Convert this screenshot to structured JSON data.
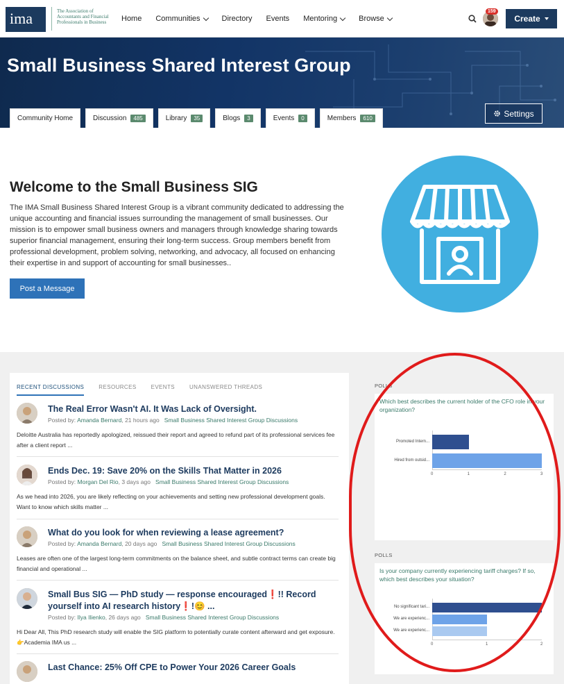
{
  "header": {
    "logo": "ima",
    "logo_text": "The Association of Accountants and Financial Professionals in Business",
    "nav": [
      "Home",
      "Communities",
      "Directory",
      "Events",
      "Mentoring",
      "Browse"
    ],
    "notifications": "159",
    "create_label": "Create"
  },
  "banner": {
    "title": "Small Business Shared Interest Group",
    "settings_label": "Settings",
    "tabs": [
      {
        "label": "Community Home",
        "count": ""
      },
      {
        "label": "Discussion",
        "count": "485"
      },
      {
        "label": "Library",
        "count": "35"
      },
      {
        "label": "Blogs",
        "count": "3"
      },
      {
        "label": "Events",
        "count": "0"
      },
      {
        "label": "Members",
        "count": "610"
      }
    ]
  },
  "welcome": {
    "title": "Welcome to the Small Business SIG",
    "text": "The IMA Small Business Shared Interest Group is a vibrant community dedicated to addressing the unique accounting and financial issues surrounding the management of small businesses. Our mission is to empower small business owners and managers through knowledge sharing towards superior financial management, ensuring their long-term success. Group members benefit from professional development, problem solving, networking, and advocacy, all focused on enhancing their expertise in and support of accounting for small businesses..",
    "post_button": "Post a Message"
  },
  "discussions": {
    "tabs": [
      "RECENT DISCUSSIONS",
      "RESOURCES",
      "EVENTS",
      "UNANSWERED THREADS"
    ],
    "posted_by": "Posted by:",
    "items": [
      {
        "title": "The Real Error Wasn't AI. It Was Lack of Oversight.",
        "author": "Amanda Bernard",
        "time": "21 hours ago",
        "group": "Small Business Shared Interest Group Discussions",
        "excerpt": "Deloitte Australia has reportedly apologized, reissued their report and agreed to refund part of its professional services fee after a client report ..."
      },
      {
        "title": "Ends Dec. 19: Save 20% on the Skills That Matter in 2026",
        "author": "Morgan Del Rio",
        "time": "3 days ago",
        "group": "Small Business Shared Interest Group Discussions",
        "excerpt": "As we head into 2026, you are likely reflecting on your achievements and setting new professional development goals. Want to know which skills matter ..."
      },
      {
        "title": "What do you look for when reviewing a lease agreement?",
        "author": "Amanda Bernard",
        "time": "20 days ago",
        "group": "Small Business Shared Interest Group Discussions",
        "excerpt": "Leases are often one of the largest long-term commitments on the balance sheet, and subtle contract terms can create big financial and operational ..."
      },
      {
        "title": "Small Bus SIG — PhD study — response encouraged❗!! Record yourself into AI research history❗!😊 ...",
        "author": "Ilya Ilienko",
        "time": "26 days ago",
        "group": "Small Business Shared Interest Group Discussions",
        "excerpt": "Hi Dear All, This PhD research study will enable the SIG platform to potentially curate content afterward and get exposure. 👉Academia IMA us ..."
      },
      {
        "title": "Last Chance: 25% Off CPE to Power Your 2026 Career Goals",
        "author": "",
        "time": "",
        "group": "",
        "excerpt": ""
      }
    ]
  },
  "polls": [
    {
      "label": "POLLS",
      "question": "Which best describes the current holder of the CFO role in your organization?",
      "chart_data": {
        "type": "bar",
        "orientation": "horizontal",
        "categories": [
          "Promoted Intern...",
          "Hired from outsid..."
        ],
        "values": [
          1,
          3
        ],
        "xlim": [
          0,
          3
        ],
        "ticks": [
          "0",
          "1",
          "2",
          "3"
        ],
        "colors": [
          "#2f4f8f",
          "#6ea3e8"
        ]
      }
    },
    {
      "label": "POLLS",
      "question": "Is your company currently experiencing tariff charges? If so, which best describes your situation?",
      "chart_data": {
        "type": "bar",
        "orientation": "horizontal",
        "categories": [
          "No significant tari...",
          "We are experienc...",
          "We are experienc..."
        ],
        "values": [
          2,
          1,
          1
        ],
        "xlim": [
          0,
          2
        ],
        "ticks": [
          "0",
          "1",
          "2"
        ],
        "colors": [
          "#2f4f8f",
          "#6ea3e8",
          "#a9c9f0"
        ]
      }
    }
  ]
}
